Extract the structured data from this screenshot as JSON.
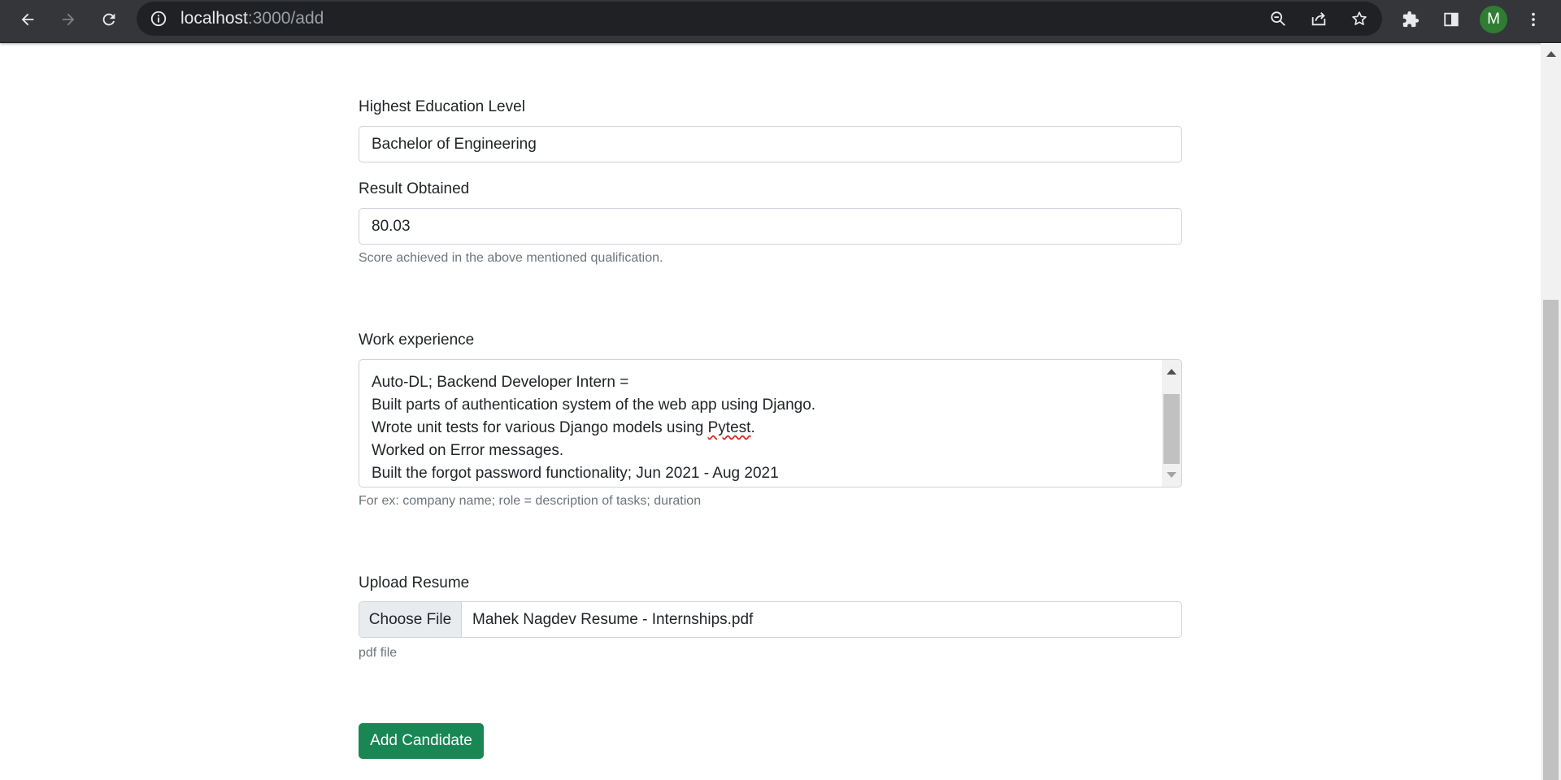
{
  "browser": {
    "url_host": "localhost",
    "url_path": ":3000/add",
    "profile_initial": "M",
    "icons": [
      "back-arrow-icon",
      "forward-arrow-icon",
      "reload-icon",
      "info-icon",
      "zoom-out-icon",
      "share-icon",
      "star-icon",
      "extensions-icon",
      "side-panel-icon",
      "more-vert-icon"
    ]
  },
  "form": {
    "education": {
      "label": "Highest Education Level",
      "value": "Bachelor of Engineering"
    },
    "result": {
      "label": "Result Obtained",
      "value": "80.03",
      "help": "Score achieved in the above mentioned qualification."
    },
    "work": {
      "label": "Work experience",
      "lines": [
        "Auto-DL; Backend Developer Intern =",
        "Built parts of authentication system of the web app using Django.",
        "Wrote unit tests for various Django models using ",
        "Worked on Error messages.",
        "Built the forgot password functionality; Jun 2021 - Aug 2021"
      ],
      "misspelled_word": "Pytest",
      "line3_suffix": ".",
      "help": "For ex: company name; role = description of tasks; duration"
    },
    "resume": {
      "label": "Upload Resume",
      "button": "Choose File",
      "filename": "Mahek Nagdev Resume - Internships.pdf",
      "help": "pdf file"
    },
    "submit_label": "Add Candidate"
  },
  "colors": {
    "toolbar": "#35363a",
    "omnibox": "#202124",
    "avatar": "#2e7d32",
    "primary_button": "#198754"
  }
}
